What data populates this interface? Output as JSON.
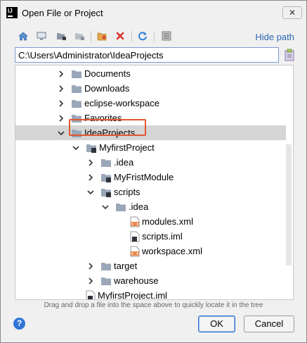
{
  "window": {
    "title": "Open File or Project",
    "app_icon_text": "IJ",
    "close_glyph": "✕"
  },
  "toolbar": {
    "buttons": [
      {
        "name": "home-icon"
      },
      {
        "name": "desktop-icon"
      },
      {
        "name": "project-icon"
      },
      {
        "name": "module-icon"
      },
      {
        "name": "new-folder-icon"
      },
      {
        "name": "delete-icon"
      },
      {
        "name": "refresh-icon"
      },
      {
        "name": "show-hidden-icon"
      }
    ],
    "hide_path_label": "Hide path"
  },
  "path": {
    "value": "C:\\Users\\Administrator\\IdeaProjects"
  },
  "tree": {
    "rows": [
      {
        "label": "Documents",
        "arrow": "right",
        "icon": "folder"
      },
      {
        "label": "Downloads",
        "arrow": "right",
        "icon": "folder"
      },
      {
        "label": "eclipse-workspace",
        "arrow": "right",
        "icon": "folder"
      },
      {
        "label": "Favorites",
        "arrow": "right",
        "icon": "folder"
      },
      {
        "label": "IdeaProjects",
        "arrow": "down",
        "icon": "folder",
        "selected": true
      },
      {
        "label": "MyfirstProject",
        "arrow": "down",
        "icon": "module-folder"
      },
      {
        "label": ".idea",
        "arrow": "right",
        "icon": "folder"
      },
      {
        "label": "MyFristModule",
        "arrow": "right",
        "icon": "module-folder"
      },
      {
        "label": "scripts",
        "arrow": "down",
        "icon": "module-folder",
        "highlighted": true
      },
      {
        "label": ".idea",
        "arrow": "down",
        "icon": "folder"
      },
      {
        "label": "modules.xml",
        "arrow": "none",
        "icon": "xml-file"
      },
      {
        "label": "scripts.iml",
        "arrow": "none",
        "icon": "iml-file"
      },
      {
        "label": "workspace.xml",
        "arrow": "none",
        "icon": "xml-file"
      },
      {
        "label": "target",
        "arrow": "right",
        "icon": "folder"
      },
      {
        "label": "warehouse",
        "arrow": "right",
        "icon": "folder"
      },
      {
        "label": "MyfirstProject.iml",
        "arrow": "none",
        "icon": "iml-file"
      }
    ]
  },
  "hint": "Drag and drop a file into the space above to quickly locate it in the tree",
  "buttons": {
    "help": "?",
    "ok": "OK",
    "cancel": "Cancel"
  },
  "colors": {
    "link": "#2a66b8",
    "highlight": "#e2572f",
    "selection": "#d5d5d5",
    "folder": "#9aa7b8"
  }
}
